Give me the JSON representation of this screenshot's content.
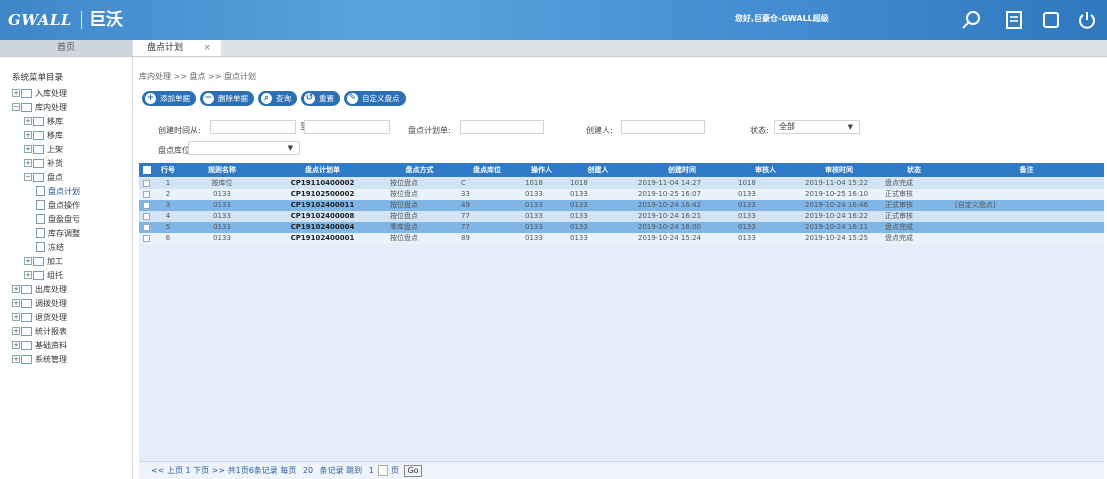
{
  "header": {
    "logo_text": "GWALL",
    "brand_name": "巨沃",
    "welcome_text": "您好,巨豪仓-GWALL超级",
    "icons": [
      "search-icon",
      "notes-icon",
      "fullscreen-icon",
      "power-icon"
    ]
  },
  "tabs": {
    "home_label": "首页",
    "active_label": "盘点计划",
    "close_symbol": "×"
  },
  "sidebar": {
    "title": "系统菜单目录",
    "items": [
      {
        "label": "入库处理",
        "level": 0,
        "expand": "+"
      },
      {
        "label": "库内处理",
        "level": 0,
        "expand": "−"
      },
      {
        "label": "移库",
        "level": 1,
        "expand": "+"
      },
      {
        "label": "移库",
        "level": 1,
        "expand": "+"
      },
      {
        "label": "上架",
        "level": 1,
        "expand": "+"
      },
      {
        "label": "补货",
        "level": 1,
        "expand": "+"
      },
      {
        "label": "盘点",
        "level": 1,
        "expand": "−"
      },
      {
        "label": "盘点计划",
        "level": 2
      },
      {
        "label": "盘点操作",
        "level": 2
      },
      {
        "label": "盘盈盘亏",
        "level": 2
      },
      {
        "label": "库存调整",
        "level": 2
      },
      {
        "label": "冻结",
        "level": 2
      },
      {
        "label": "加工",
        "level": 1,
        "expand": "+"
      },
      {
        "label": "组托",
        "level": 1,
        "expand": "+"
      },
      {
        "label": "出库处理",
        "level": 0,
        "expand": "+"
      },
      {
        "label": "调拨处理",
        "level": 0,
        "expand": "+"
      },
      {
        "label": "退货处理",
        "level": 0,
        "expand": "+"
      },
      {
        "label": "统计报表",
        "level": 0,
        "expand": "+"
      },
      {
        "label": "基础资料",
        "level": 0,
        "expand": "+"
      },
      {
        "label": "系统管理",
        "level": 0,
        "expand": "+"
      }
    ]
  },
  "breadcrumb": "库内处理 >> 盘点 >> 盘点计划",
  "buttons": [
    {
      "label": "添加单据",
      "icon": "plus-icon",
      "symbol": "+"
    },
    {
      "label": "删除单据",
      "icon": "minus-icon",
      "symbol": "−"
    },
    {
      "label": "查询",
      "icon": "search-icon",
      "symbol": "⌕"
    },
    {
      "label": "重置",
      "icon": "reset-icon",
      "symbol": "↺"
    },
    {
      "label": "自定义盘点",
      "icon": "gear-icon",
      "symbol": "✎"
    }
  ],
  "filters": {
    "created_time_label": "创建时间从:",
    "date_separator": "至",
    "plan_no_label": "盘点计划单:",
    "creator_label": "创建人:",
    "status_label": "状态:",
    "status_value": "全部",
    "warehouse_label": "盘点库位:"
  },
  "table": {
    "columns": [
      "行号",
      "规则名称",
      "盘点计划单",
      "盘点方式",
      "盘点库位",
      "操作人",
      "创建人",
      "创建时间",
      "审核人",
      "审核时间",
      "状态",
      "备注"
    ],
    "rows": [
      {
        "row": "1",
        "rule": "按库位",
        "plan_no": "CP19110400002",
        "method": "按位盘点",
        "loc": "C",
        "operator": "1018",
        "creator": "1018",
        "created": "2019-11-04 14:27",
        "auditor": "1018",
        "audited": "2019-11-04 15:22",
        "status": "盘点完成",
        "remark": ""
      },
      {
        "row": "2",
        "rule": "0133",
        "plan_no": "CP19102500002",
        "method": "按位盘点",
        "loc": "33",
        "operator": "0133",
        "creator": "0133",
        "created": "2019-10-25 16:07",
        "auditor": "0133",
        "audited": "2019-10-25 16:10",
        "status": "正式审核",
        "remark": ""
      },
      {
        "row": "3",
        "rule": "0133",
        "plan_no": "CP19102400011",
        "method": "按位盘点",
        "loc": "49",
        "operator": "0133",
        "creator": "0133",
        "created": "2019-10-24 16:42",
        "auditor": "0133",
        "audited": "2019-10-24 16:46",
        "status": "正式审核",
        "remark": "[自定义盘点]"
      },
      {
        "row": "4",
        "rule": "0133",
        "plan_no": "CP19102400008",
        "method": "按位盘点",
        "loc": "77",
        "operator": "0133",
        "creator": "0133",
        "created": "2019-10-24 16:21",
        "auditor": "0133",
        "audited": "2019-10-24 16:22",
        "status": "正式审核",
        "remark": ""
      },
      {
        "row": "5",
        "rule": "0133",
        "plan_no": "CP19102400004",
        "method": "零库盘点",
        "loc": "77",
        "operator": "0133",
        "creator": "0133",
        "created": "2019-10-24 16:00",
        "auditor": "0133",
        "audited": "2019-10-24 16:11",
        "status": "盘点完成",
        "remark": ""
      },
      {
        "row": "6",
        "rule": "0133",
        "plan_no": "CP19102400001",
        "method": "按位盘点",
        "loc": "89",
        "operator": "0133",
        "creator": "0133",
        "created": "2019-10-24 15:24",
        "auditor": "0133",
        "audited": "2019-10-24 15:25",
        "status": "盘点完成",
        "remark": ""
      }
    ]
  },
  "pager": {
    "text": "<< 上页 1 下页 >> 共1页6条记录 每页",
    "page_size": "20",
    "records_label": "条记录 跳到",
    "page_value": "1",
    "page_unit": "页",
    "go_label": "Go"
  },
  "colors": {
    "header_blue": "#3f86c9",
    "grid_head": "#2f7ac6",
    "selected_row": "#7fb6e6",
    "button_blue": "#2c6fb3"
  }
}
